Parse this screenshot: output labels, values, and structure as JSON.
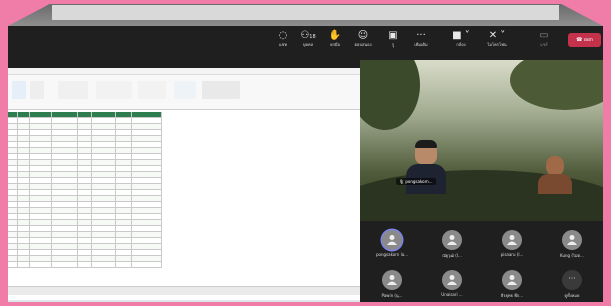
{
  "toolbar": {
    "chat": "แชท",
    "people_count": "18",
    "people": "บุคคล",
    "raise": "ยกมือ",
    "react": "ตอบสนอง",
    "rooms": "รู",
    "more": "เพิ่มเติม",
    "camera": "กล้อง",
    "mic": "ไมโครโฟน",
    "share": "แชร์",
    "leave": "ออก"
  },
  "camera_tile": {
    "name": "pongsakorn..."
  },
  "participants": [
    {
      "name": "pongsakorn la..."
    },
    {
      "name": "ณัฐวุฒิ (I..."
    },
    {
      "name": "pisaaru (I..."
    },
    {
      "name": "Kung (ไม่ต..."
    },
    {
      "name": "Pawin (นุ..."
    },
    {
      "name": "Unaisari ..."
    },
    {
      "name": "ธีรยุทธ พี่ก..."
    },
    {
      "name": "ดูทั้งหมด"
    }
  ],
  "colors": {
    "end_call": "#c4314b",
    "selected_ring": "#7b83eb",
    "excel_green": "#2e7d4f"
  }
}
